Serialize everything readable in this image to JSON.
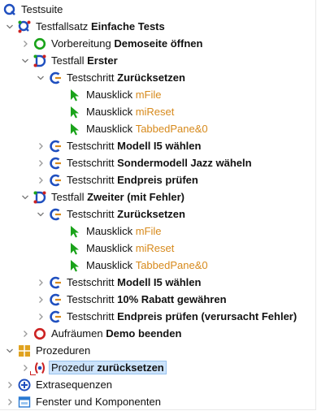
{
  "tree": {
    "root": {
      "label": "Testsuite"
    },
    "testcase_set": {
      "prefix": "Testfallsatz",
      "name": "Einfache Tests"
    },
    "setup": {
      "prefix": "Vorbereitung",
      "name": "Demoseite öffnen"
    },
    "case1": {
      "prefix": "Testfall",
      "name": "Erster"
    },
    "case1_step1": {
      "prefix": "Testschritt",
      "name": "Zurücksetzen"
    },
    "case1_click1": {
      "prefix": "Mausklick",
      "target": "mFile"
    },
    "case1_click2": {
      "prefix": "Mausklick",
      "target": "miReset"
    },
    "case1_click3": {
      "prefix": "Mausklick",
      "target": "TabbedPane&0"
    },
    "case1_step2": {
      "prefix": "Testschritt",
      "name": "Modell I5 wählen"
    },
    "case1_step3": {
      "prefix": "Testschritt",
      "name": "Sondermodell Jazz wäheln"
    },
    "case1_step4": {
      "prefix": "Testschritt",
      "name": "Endpreis prüfen"
    },
    "case2": {
      "prefix": "Testfall",
      "name": "Zweiter (mit Fehler)"
    },
    "case2_step1": {
      "prefix": "Testschritt",
      "name": "Zurücksetzen"
    },
    "case2_click1": {
      "prefix": "Mausklick",
      "target": "mFile"
    },
    "case2_click2": {
      "prefix": "Mausklick",
      "target": "miReset"
    },
    "case2_click3": {
      "prefix": "Mausklick",
      "target": "TabbedPane&0"
    },
    "case2_step2": {
      "prefix": "Testschritt",
      "name": "Modell I5 wählen"
    },
    "case2_step3": {
      "prefix": "Testschritt",
      "name": "10% Rabatt gewähren"
    },
    "case2_step4": {
      "prefix": "Testschritt",
      "name": "Endpreis prüfen (verursacht Fehler)"
    },
    "cleanup": {
      "prefix": "Aufräumen",
      "name": "Demo beenden"
    },
    "procedures": {
      "label": "Prozeduren"
    },
    "procedure": {
      "prefix": "Prozedur",
      "name": "zurücksetzen"
    },
    "extras": {
      "label": "Extrasequenzen"
    },
    "windows": {
      "label": "Fenster und Komponenten"
    }
  },
  "colors": {
    "accent_blue": "#1f4fbf",
    "green": "#1aa31a",
    "red": "#cc2222",
    "orange": "#d78a1c",
    "selection": "#cce3fb"
  },
  "icons": {
    "root": "testsuite-icon",
    "set": "testcase-set-icon",
    "setup": "setup-icon",
    "case": "testcase-icon",
    "step": "teststep-icon",
    "click": "mouse-click-icon",
    "cleanup": "cleanup-icon",
    "procedures": "procedures-icon",
    "procedure": "procedure-icon",
    "extras": "extras-icon",
    "windows": "windows-icon"
  }
}
